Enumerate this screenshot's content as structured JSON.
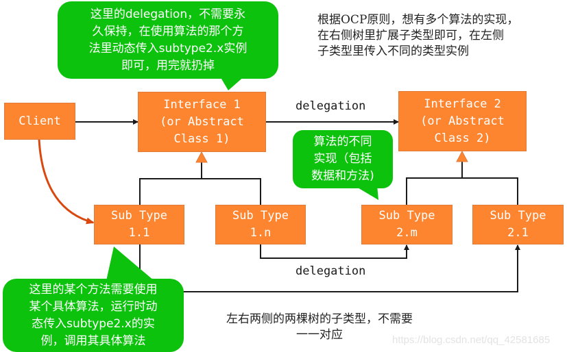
{
  "colors": {
    "box_fill": "#fd8530",
    "bubble_fill": "#0dc20d",
    "line": "#1a1a1a",
    "client_arrow": "#d9480f"
  },
  "boxes": {
    "client": [
      "Client"
    ],
    "interface1": [
      "Interface 1",
      "(or Abstract",
      "Class 1)"
    ],
    "interface2": [
      "Interface 2",
      "(or Abstract",
      "Class 2)"
    ],
    "sub11": [
      "Sub Type",
      "1.1"
    ],
    "sub1n": [
      "Sub Type",
      "1.n"
    ],
    "sub2m": [
      "Sub Type",
      "2.m"
    ],
    "sub21": [
      "Sub Type",
      "2.1"
    ]
  },
  "labels": {
    "delegation_top": "delegation",
    "delegation_bottom": "delegation"
  },
  "bubbles": {
    "top": [
      "这里的delegation，不需要永",
      "久保持，在使用算法的那个方",
      "法里动态传入subtype2.x实例",
      "即可，用完就扔掉"
    ],
    "middle": [
      "算法的不同",
      "实现（包括",
      "数据和方法)"
    ],
    "bottom": [
      "这里的某个方法需要使用",
      "某个具体算法，运行时动",
      "态传入subtype2.x的实",
      "例，调用其具体算法"
    ]
  },
  "notes": {
    "top_right": [
      "根据OCP原则，想有多个算法的实现，",
      "在右侧树里扩展子类型即可，在左侧",
      "子类型里传入不同的类型实例"
    ],
    "bottom": [
      "左右两侧的两棵树的子类型，不需要",
      "一一对应"
    ]
  },
  "watermark": "https://blog.csdn.net/qq_42581685"
}
